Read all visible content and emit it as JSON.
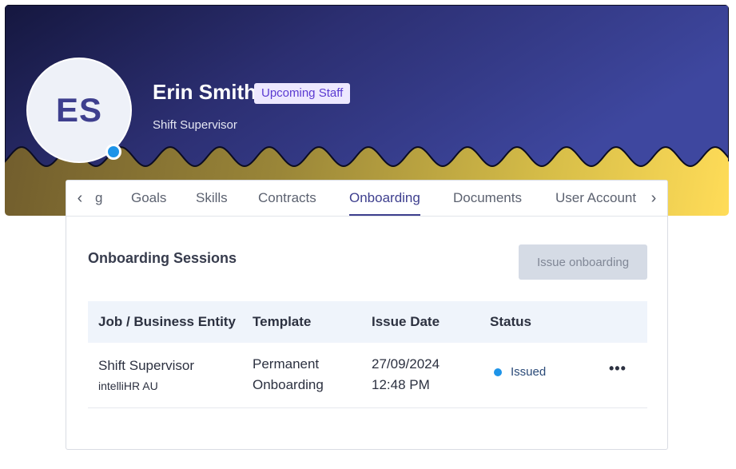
{
  "profile": {
    "initials": "ES",
    "name": "Erin Smith",
    "badge": "Upcoming Staff",
    "job_title": "Shift Supervisor"
  },
  "tabs": {
    "prev_icon": "‹",
    "next_icon": "›",
    "items": [
      {
        "label": "g"
      },
      {
        "label": "Goals"
      },
      {
        "label": "Skills"
      },
      {
        "label": "Contracts"
      },
      {
        "label": "Onboarding"
      },
      {
        "label": "Documents"
      },
      {
        "label": "User Account"
      }
    ],
    "active": "Onboarding"
  },
  "onboarding": {
    "section_title": "Onboarding Sessions",
    "issue_button": "Issue onboarding",
    "columns": [
      "Job / Business Entity",
      "Template",
      "Issue Date",
      "Status"
    ],
    "rows": [
      {
        "job": "Shift Supervisor",
        "entity": "intelliHR AU",
        "template_line1": "Permanent",
        "template_line2": "Onboarding",
        "date": "27/09/2024",
        "time": "12:48 PM",
        "status": "Issued",
        "more": "•••"
      }
    ]
  },
  "colors": {
    "accent": "#3e3f8e",
    "status_issued": "#1e94e8",
    "badge_bg": "#ede8ff",
    "badge_text": "#5a3ad1"
  }
}
